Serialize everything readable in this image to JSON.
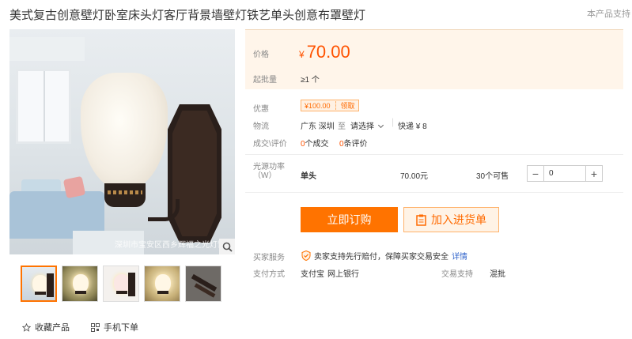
{
  "product": {
    "title": "美式复古创意壁灯卧室床头灯客厅背景墙壁灯铁艺单头创意布罩壁灯",
    "note": "本产品支持",
    "watermark": "深圳市宝安区西乡辉福之光灯饰"
  },
  "price": {
    "label": "价格",
    "currency": "¥",
    "value": "70.00",
    "moq_label": "起批量",
    "moq_value": "≥1 个"
  },
  "promo": {
    "label": "优惠",
    "coupon_value": "¥100.00",
    "coupon_action": "领取"
  },
  "logistics": {
    "label": "物流",
    "origin": "广东 深圳",
    "to": "至",
    "destination": "请选择",
    "shipping": "快递 ¥ 8"
  },
  "sales": {
    "label": "成交\\评价",
    "deals_count": "0",
    "deals_unit": "个成交",
    "reviews_count": "0",
    "reviews_unit": "条评价"
  },
  "sku": {
    "label": "光源功率（W）",
    "option": "单头",
    "price": "70.00元",
    "stock": "30个可售",
    "quantity": "0"
  },
  "actions": {
    "buy": "立即订购",
    "cart": "加入进货单"
  },
  "service": {
    "label": "买家服务",
    "text": "卖家支持先行赔付，保障买家交易安全",
    "detail": "详情"
  },
  "payment": {
    "label": "支付方式",
    "methods": [
      "支付宝",
      "网上银行"
    ],
    "trade_label": "交易支持",
    "trade_value": "混批"
  },
  "footer": {
    "favorite": "收藏产品",
    "mobile": "手机下单"
  },
  "colors": {
    "accent": "#ff7300",
    "price": "#ff5200",
    "price_bg": "#fff5ea"
  }
}
